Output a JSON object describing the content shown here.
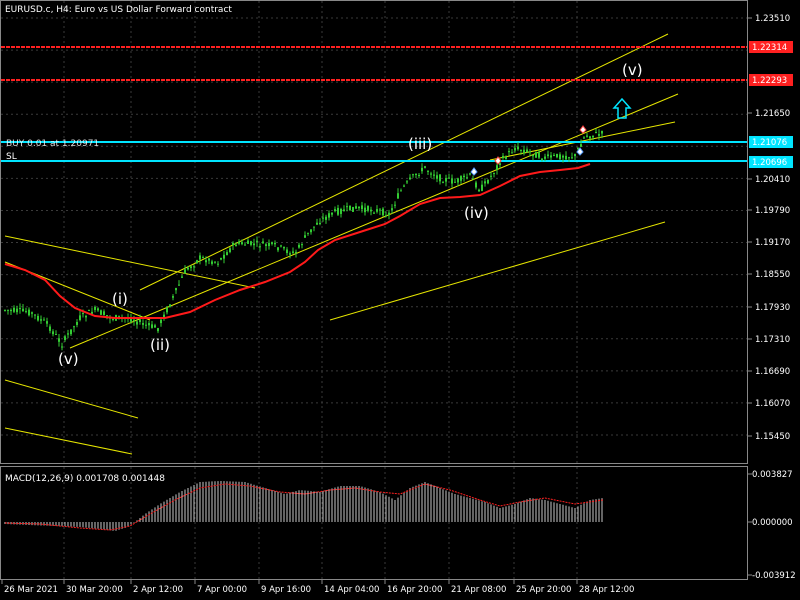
{
  "window": {
    "title": "EURUSD.c, H4:  Euro vs US Dollar Forward contract"
  },
  "colors": {
    "background": "#000000",
    "grid": "#3a3a3a",
    "bull_candle": "#33cc33",
    "bear_candle": "#33cc33",
    "moving_average": "#ff1a1a",
    "channel_lines": "#e6e600",
    "target_lines": "#ff2020",
    "entry_lines": "#00e5ff",
    "macd_histogram": "#c8c8c8",
    "macd_signal": "#ff2020",
    "arrow": "#00e5ff"
  },
  "price_axis": {
    "labels": [
      "1.23510",
      "1.22314",
      "1.22293",
      "1.21650",
      "1.21076",
      "1.20696",
      "1.20410",
      "1.19790",
      "1.19170",
      "1.18550",
      "1.17930",
      "1.17310",
      "1.16690",
      "1.16070",
      "1.15450"
    ]
  },
  "time_axis": {
    "labels": [
      "26 Mar 2021",
      "30 Mar 20:00",
      "2 Apr 12:00",
      "7 Apr 00:00",
      "9 Apr 16:00",
      "14 Apr 04:00",
      "16 Apr 20:00",
      "21 Apr 08:00",
      "25 Apr 20:00",
      "28 Apr 12:00"
    ]
  },
  "price_tags": [
    {
      "label": "1.22314",
      "role": "target-1"
    },
    {
      "label": "1.22293",
      "role": "target-2"
    },
    {
      "label": "1.21076",
      "role": "entry"
    },
    {
      "label": "1.20696",
      "role": "stop-loss"
    }
  ],
  "order_lines": {
    "buy_label": "BUY 0.01 at 1.20971",
    "sl_label": "SL"
  },
  "wave_labels": {
    "v_low": "(v)",
    "i": "(i)",
    "ii": "(ii)",
    "iii": "(iii)",
    "iv": "(iv)",
    "v_target": "(v)"
  },
  "macd": {
    "title": "MACD(12,26,9) 0.001708 0.001448",
    "axis_labels": [
      "0.003827",
      "0.000000",
      "-0.003912"
    ]
  }
}
